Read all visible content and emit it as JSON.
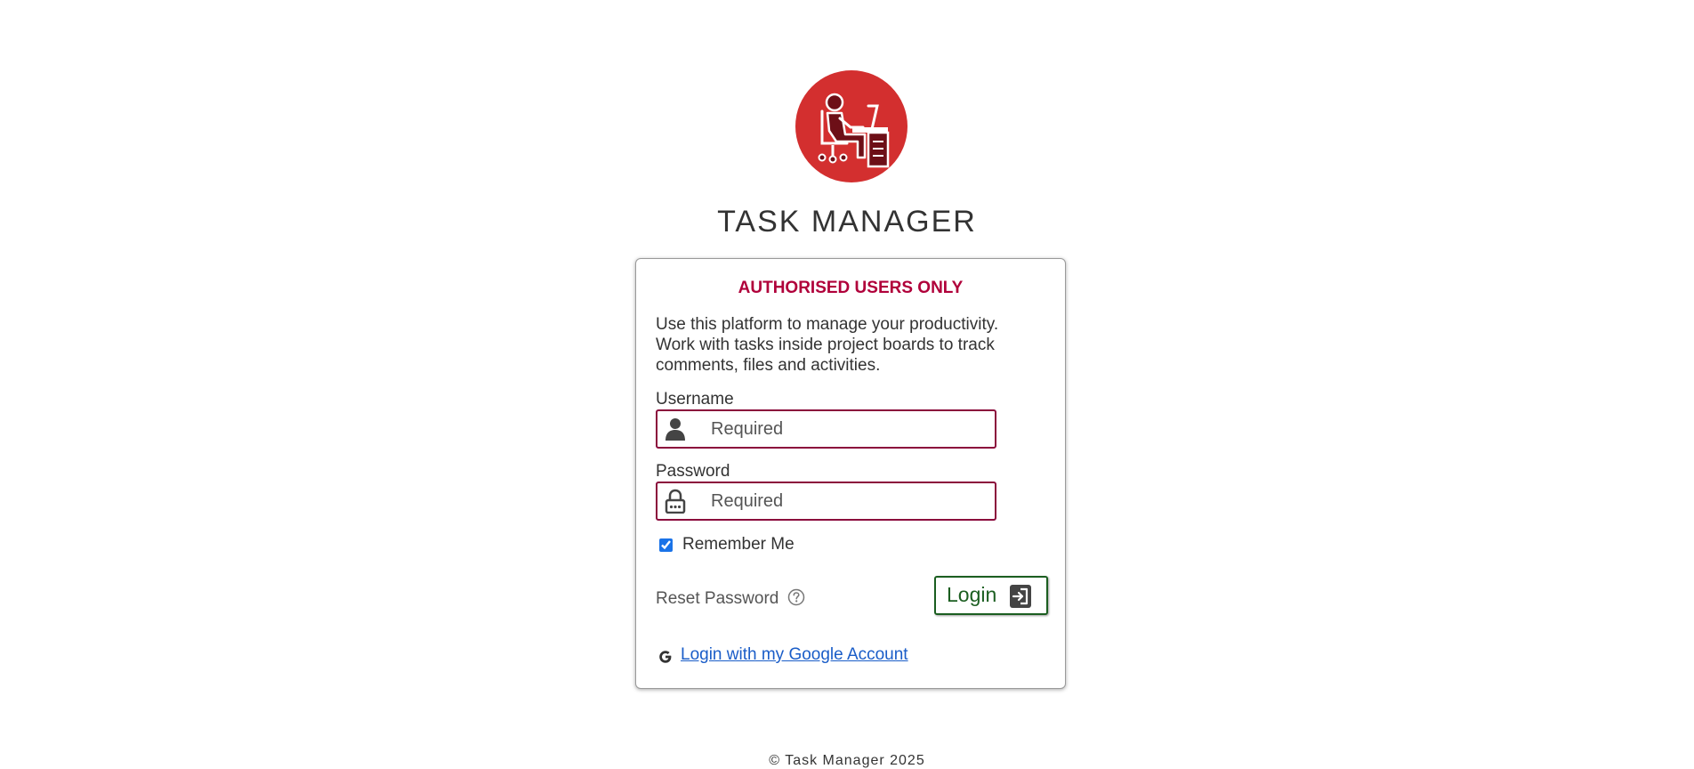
{
  "app": {
    "title": "TASK MANAGER",
    "brand_color": "#d32f2f"
  },
  "login_card": {
    "warning": "AUTHORISED USERS ONLY",
    "warning_color": "#b0003a",
    "intro": "Use this platform to manage your productivity. Work with tasks inside project boards to track comments, files and activities.",
    "username": {
      "label": "Username",
      "placeholder": "Required",
      "value": "",
      "icon": "user-icon"
    },
    "password": {
      "label": "Password",
      "placeholder": "Required",
      "value": "",
      "icon": "lock-icon"
    },
    "remember_me": {
      "label": "Remember Me",
      "checked": true
    },
    "reset_password": {
      "label": "Reset Password",
      "icon": "help-icon"
    },
    "login_button": {
      "label": "Login",
      "icon": "login-icon",
      "color": "#1b5e20"
    },
    "google_login": {
      "label": "Login with my Google Account",
      "icon": "google-icon",
      "color": "#1a5dc8"
    }
  },
  "footer": {
    "text": "©  Task Manager 2025"
  }
}
